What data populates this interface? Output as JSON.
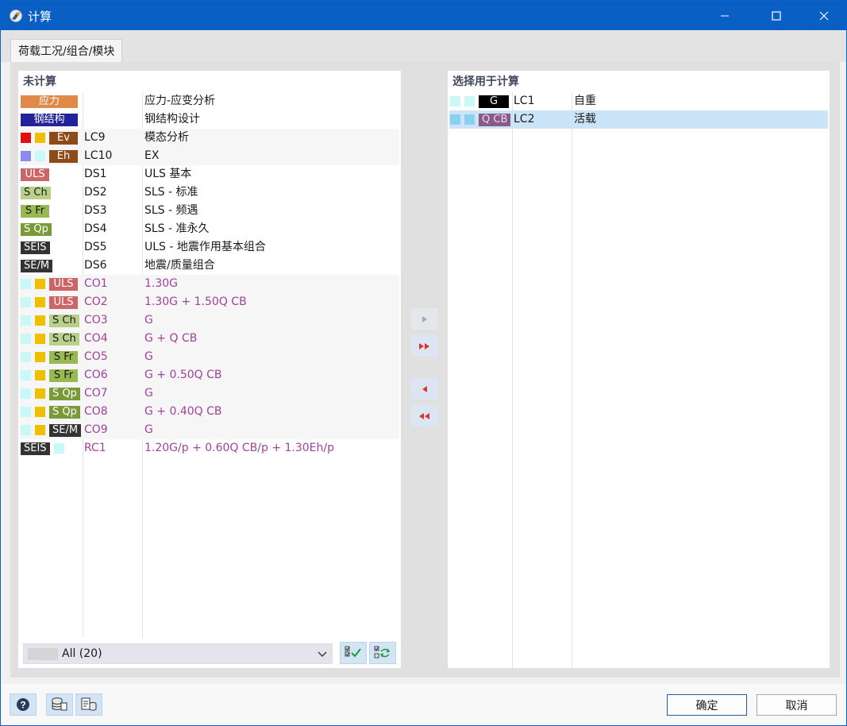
{
  "window": {
    "title": "计算"
  },
  "tabs": [
    {
      "label": "荷载工况/组合/模块"
    }
  ],
  "left_panel": {
    "header": "未计算",
    "filter": {
      "selected": "All (20)"
    },
    "rows": [
      {
        "badge": "应力",
        "badge_bg": "#e08a4a",
        "badge_fg": "#ffffff",
        "squares": [],
        "code": "",
        "desc": "应力-应变分析",
        "purple": false,
        "shaded": false
      },
      {
        "badge": "钢结构",
        "badge_bg": "#22229a",
        "badge_fg": "#ffffff",
        "squares": [],
        "code": "",
        "desc": "钢结构设计",
        "purple": false,
        "shaded": false
      },
      {
        "badge": "Ev",
        "badge_bg": "#8f4a1a",
        "badge_fg": "#ffffff",
        "squares": [
          "#e01010",
          "#f0c000"
        ],
        "code": "LC9",
        "desc": "模态分析",
        "purple": false,
        "shaded": true
      },
      {
        "badge": "Eh",
        "badge_bg": "#8f4a1a",
        "badge_fg": "#ffffff",
        "squares": [
          "#8a8af0",
          "#c8f8f8"
        ],
        "code": "LC10",
        "desc": "EX",
        "purple": false,
        "shaded": true
      },
      {
        "badge": "ULS",
        "badge_bg": "#cc6666",
        "badge_fg": "#ffffff",
        "squares": [],
        "code": "DS1",
        "desc": "ULS 基本",
        "purple": false,
        "shaded": false
      },
      {
        "badge": "S Ch",
        "badge_bg": "#b8d08a",
        "badge_fg": "#1a1a1a",
        "squares": [],
        "code": "DS2",
        "desc": "SLS - 标准",
        "purple": false,
        "shaded": false
      },
      {
        "badge": "S Fr",
        "badge_bg": "#98b850",
        "badge_fg": "#1a1a1a",
        "squares": [],
        "code": "DS3",
        "desc": "SLS - 频遇",
        "purple": false,
        "shaded": false
      },
      {
        "badge": "S Qp",
        "badge_bg": "#7a9a38",
        "badge_fg": "#ffffff",
        "squares": [],
        "code": "DS4",
        "desc": "SLS - 准永久",
        "purple": false,
        "shaded": false
      },
      {
        "badge": "SEIS",
        "badge_bg": "#333333",
        "badge_fg": "#ffffff",
        "squares": [],
        "code": "DS5",
        "desc": "ULS - 地震作用基本组合",
        "purple": false,
        "shaded": false
      },
      {
        "badge": "SE/M",
        "badge_bg": "#333333",
        "badge_fg": "#ffffff",
        "squares": [],
        "code": "DS6",
        "desc": "地震/质量组合",
        "purple": false,
        "shaded": false
      },
      {
        "badge": "ULS",
        "badge_bg": "#cc6666",
        "badge_fg": "#ffffff",
        "squares": [
          "#c8f8f8",
          "#f0c000"
        ],
        "code": "CO1",
        "desc": "1.30G",
        "purple": true,
        "shaded": true
      },
      {
        "badge": "ULS",
        "badge_bg": "#cc6666",
        "badge_fg": "#ffffff",
        "squares": [
          "#c8f8f8",
          "#f0c000"
        ],
        "code": "CO2",
        "desc": "1.30G + 1.50Q CB",
        "purple": true,
        "shaded": true
      },
      {
        "badge": "S Ch",
        "badge_bg": "#b8d08a",
        "badge_fg": "#1a1a1a",
        "squares": [
          "#c8f8f8",
          "#f0c000"
        ],
        "code": "CO3",
        "desc": "G",
        "purple": true,
        "shaded": true
      },
      {
        "badge": "S Ch",
        "badge_bg": "#b8d08a",
        "badge_fg": "#1a1a1a",
        "squares": [
          "#c8f8f8",
          "#f0c000"
        ],
        "code": "CO4",
        "desc": "G + Q CB",
        "purple": true,
        "shaded": true
      },
      {
        "badge": "S Fr",
        "badge_bg": "#98b850",
        "badge_fg": "#1a1a1a",
        "squares": [
          "#c8f8f8",
          "#f0c000"
        ],
        "code": "CO5",
        "desc": "G",
        "purple": true,
        "shaded": true
      },
      {
        "badge": "S Fr",
        "badge_bg": "#98b850",
        "badge_fg": "#1a1a1a",
        "squares": [
          "#c8f8f8",
          "#f0c000"
        ],
        "code": "CO6",
        "desc": "G + 0.50Q CB",
        "purple": true,
        "shaded": true
      },
      {
        "badge": "S Qp",
        "badge_bg": "#7a9a38",
        "badge_fg": "#ffffff",
        "squares": [
          "#c8f8f8",
          "#f0c000"
        ],
        "code": "CO7",
        "desc": "G",
        "purple": true,
        "shaded": true
      },
      {
        "badge": "S Qp",
        "badge_bg": "#7a9a38",
        "badge_fg": "#ffffff",
        "squares": [
          "#c8f8f8",
          "#f0c000"
        ],
        "code": "CO8",
        "desc": "G + 0.40Q CB",
        "purple": true,
        "shaded": true
      },
      {
        "badge": "SE/M",
        "badge_bg": "#333333",
        "badge_fg": "#ffffff",
        "squares": [
          "#c8f8f8",
          "#f0c000"
        ],
        "code": "CO9",
        "desc": "G",
        "purple": true,
        "shaded": true
      },
      {
        "badge": "SEIS",
        "badge_bg": "#333333",
        "badge_fg": "#ffffff",
        "squares": [
          "#c8f8f8"
        ],
        "code": "RC1",
        "desc": "1.20G/p + 0.60Q CB/p + 1.30Eh/p",
        "purple": true,
        "shaded": false,
        "badge_first": true
      }
    ]
  },
  "right_panel": {
    "header": "选择用于计算",
    "rows": [
      {
        "badge": "G",
        "badge_bg": "#000000",
        "badge_fg": "#ffffff",
        "squares": [
          "#c8f8f8",
          "#c8f8f8"
        ],
        "code": "LC1",
        "desc": "自重",
        "selected": false
      },
      {
        "badge": "Q CB",
        "badge_bg": "#8a5a8a",
        "badge_fg": "#e8d8e8",
        "squares": [
          "#8ad0f0",
          "#8ad0f0"
        ],
        "code": "LC2",
        "desc": "活载",
        "selected": true
      }
    ]
  },
  "footer": {
    "ok": "确定",
    "cancel": "取消"
  },
  "colors": {
    "titlebar": "#0a5fc4",
    "accent_purple": "#a0429c",
    "selection": "#cce4f7"
  }
}
